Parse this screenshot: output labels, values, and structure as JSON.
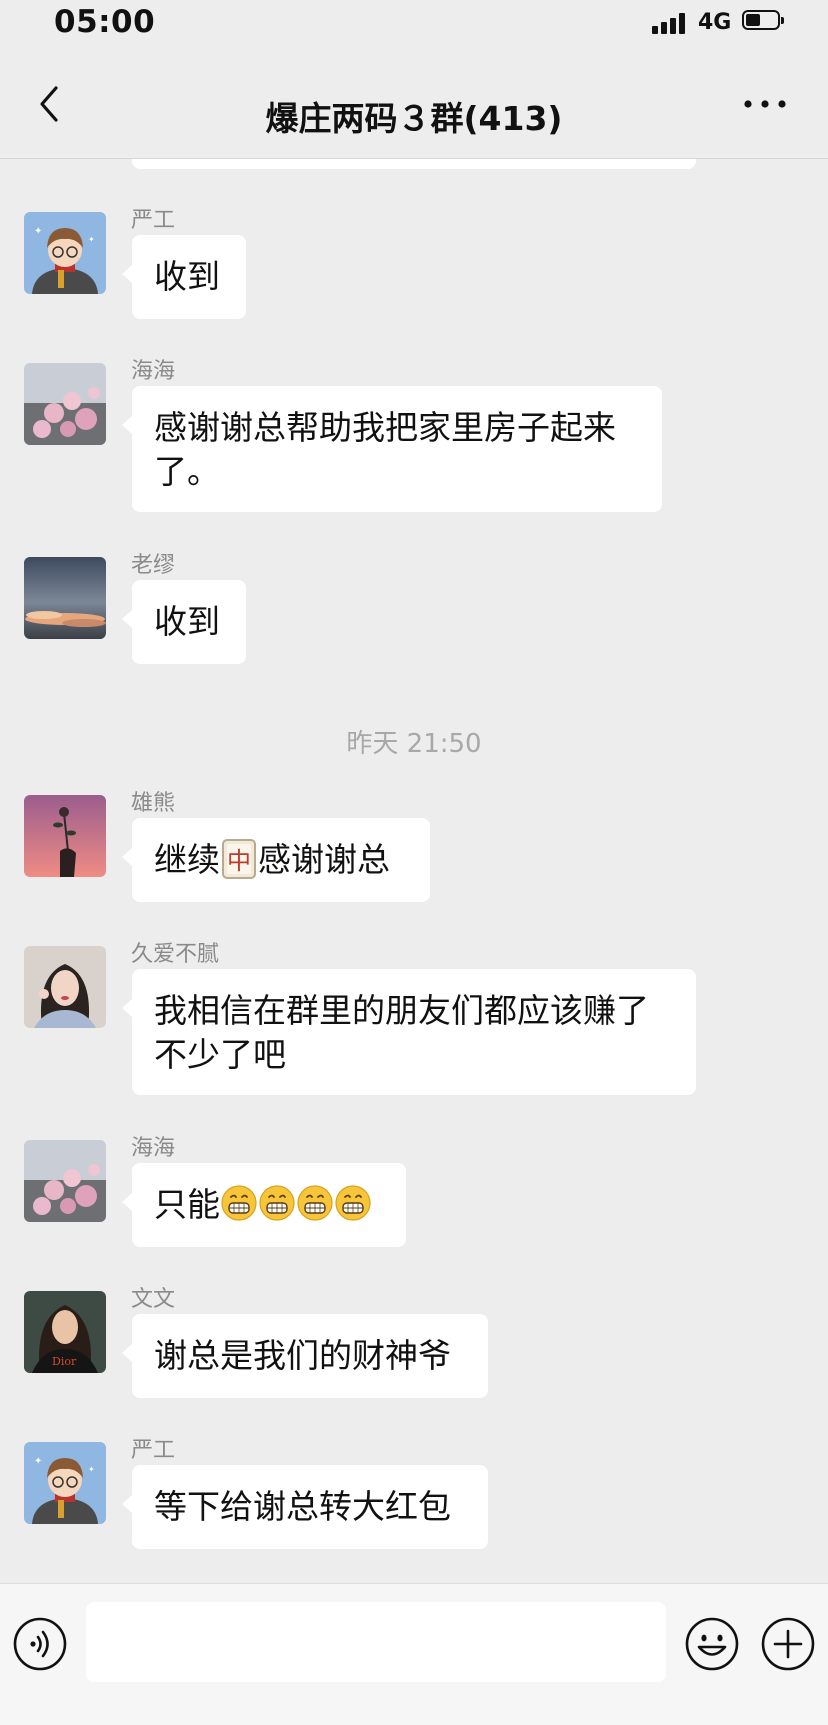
{
  "status_bar": {
    "time": "05:00",
    "network": "4G",
    "battery_level": 0.45
  },
  "header": {
    "title": "爆庄两码３群(413)",
    "back_icon": "chevron-left-icon",
    "more_icon": "more-dots-icon"
  },
  "messages": [
    {
      "sender": "严工",
      "text": "收到",
      "avatar": "cartoon-boy-avatar"
    },
    {
      "sender": "海海",
      "line1": "感谢谢总帮助我把家里房子起来",
      "line2": "了。",
      "avatar": "pink-flowers-avatar"
    },
    {
      "sender": "老缪",
      "text": "收到",
      "avatar": "sunset-clouds-avatar"
    },
    {
      "sender": "雄熊",
      "pre": "继续",
      "post": "感谢谢总",
      "avatar": "hand-flower-avatar"
    },
    {
      "sender": "久爱不腻",
      "line1": "我相信在群里的朋友们都应该赚了",
      "line2": "不少了吧",
      "avatar": "girl-portrait-avatar"
    },
    {
      "sender": "海海",
      "pre": "只能",
      "emoji_count": 4,
      "avatar": "pink-flowers-avatar"
    },
    {
      "sender": "文文",
      "text": "谢总是我们的财神爷",
      "avatar": "woman-dior-avatar"
    },
    {
      "sender": "严工",
      "text": "等下给谢总转大红包",
      "avatar": "cartoon-boy-avatar"
    }
  ],
  "timestamp": "昨天 21:50",
  "colors": {
    "background": "#EDEDED",
    "bubble": "#FFFFFF",
    "sender": "#8A8A8A",
    "timestamp": "#A8A8A8"
  },
  "input": {
    "value": "",
    "voice_icon": "voice-icon",
    "emoji_icon": "smiley-icon",
    "plus_icon": "plus-icon"
  }
}
